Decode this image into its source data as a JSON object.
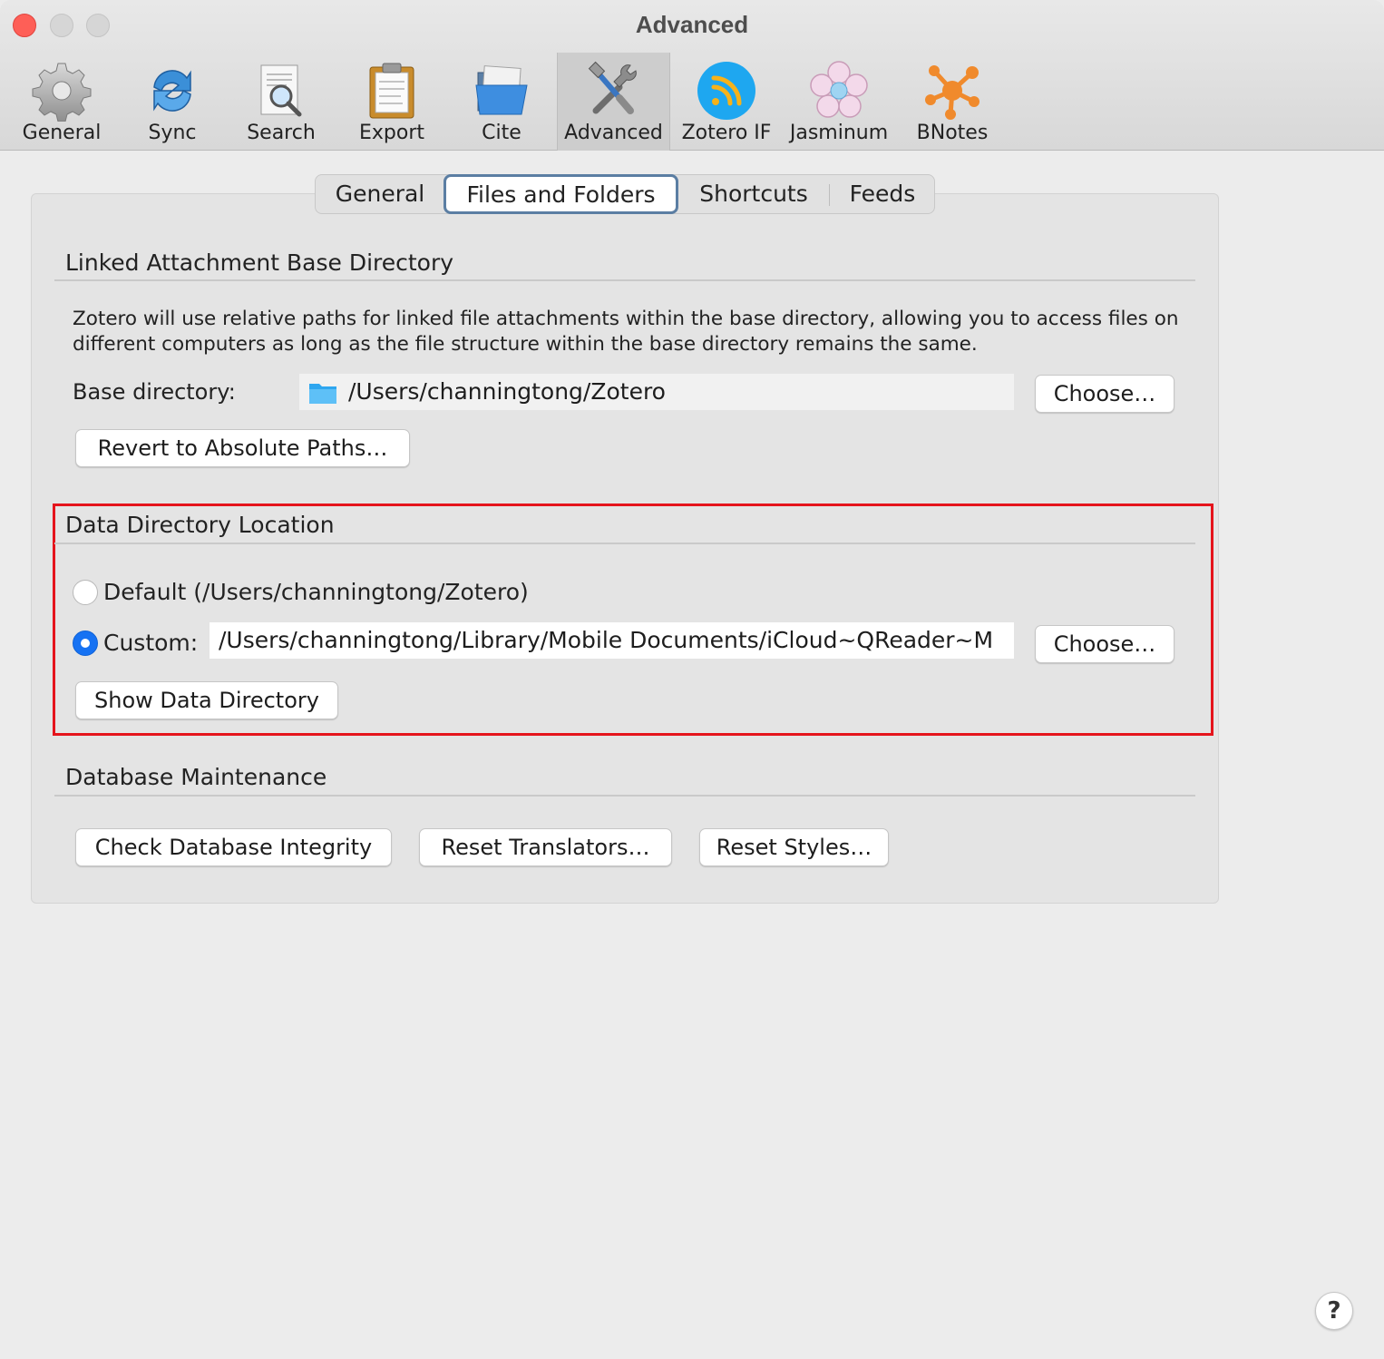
{
  "window": {
    "title": "Advanced"
  },
  "toolbar": {
    "items": [
      {
        "label": "General",
        "icon": "gear-icon"
      },
      {
        "label": "Sync",
        "icon": "sync-icon"
      },
      {
        "label": "Search",
        "icon": "search-icon"
      },
      {
        "label": "Export",
        "icon": "clipboard-icon"
      },
      {
        "label": "Cite",
        "icon": "folder-icon"
      },
      {
        "label": "Advanced",
        "icon": "tools-icon"
      },
      {
        "label": "Zotero IF",
        "icon": "rss-icon"
      },
      {
        "label": "Jasminum",
        "icon": "flower-icon"
      },
      {
        "label": "BNotes",
        "icon": "network-icon"
      }
    ],
    "selected": "Advanced"
  },
  "tabs": {
    "items": [
      "General",
      "Files and Folders",
      "Shortcuts",
      "Feeds"
    ],
    "active": "Files and Folders"
  },
  "linked": {
    "title": "Linked Attachment Base Directory",
    "description": "Zotero will use relative paths for linked file attachments within the base directory, allowing you to access files on different computers as long as the file structure within the base directory remains the same.",
    "base_label": "Base directory:",
    "base_value": "/Users/channingtong/Zotero",
    "choose_label": "Choose…",
    "revert_label": "Revert to Absolute Paths…"
  },
  "data_dir": {
    "title": "Data Directory Location",
    "default_label": "Default (/Users/channingtong/Zotero)",
    "default_selected": false,
    "custom_label": "Custom:",
    "custom_selected": true,
    "custom_value": "/Users/channingtong/Library/Mobile Documents/iCloud~QReader~M",
    "choose_label": "Choose…",
    "show_label": "Show Data Directory"
  },
  "db": {
    "title": "Database Maintenance",
    "check_label": "Check Database Integrity",
    "reset_translators_label": "Reset Translators…",
    "reset_styles_label": "Reset Styles…"
  },
  "help": {
    "label": "?"
  },
  "colors": {
    "accent": "#1672f3",
    "highlight_border": "#e5141c",
    "close_button": "#fe5f57"
  }
}
